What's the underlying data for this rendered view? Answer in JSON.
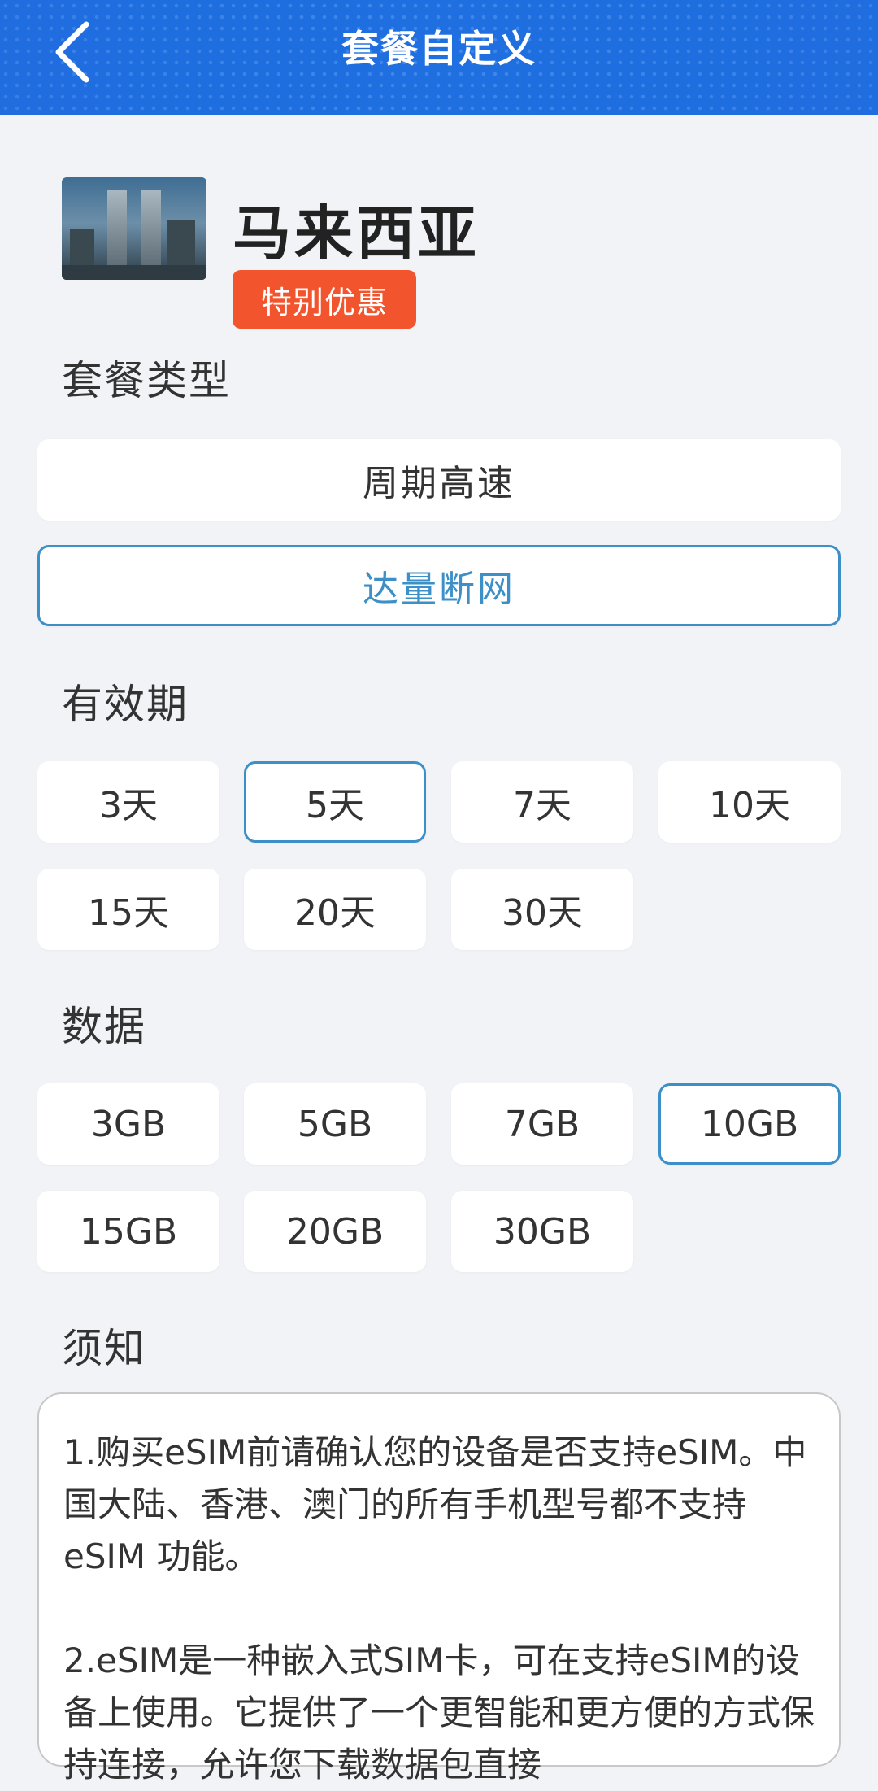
{
  "header": {
    "title": "套餐自定义"
  },
  "product": {
    "country": "马来西亚",
    "badge": "特别优惠"
  },
  "plan_type": {
    "title": "套餐类型",
    "options": [
      "周期高速",
      "达量断网"
    ],
    "selected": "达量断网"
  },
  "validity": {
    "title": "有效期",
    "options": [
      "3天",
      "5天",
      "7天",
      "10天",
      "15天",
      "20天",
      "30天"
    ],
    "selected": "5天"
  },
  "data_plan": {
    "title": "数据",
    "options": [
      "3GB",
      "5GB",
      "7GB",
      "10GB",
      "15GB",
      "20GB",
      "30GB"
    ],
    "selected": "10GB"
  },
  "notice": {
    "title": "须知",
    "paragraphs": [
      "1.购买eSIM前请确认您的设备是否支持eSIM。中国大陆、香港、澳门的所有手机型号都不支持 eSIM 功能。",
      "2.eSIM是一种嵌入式SIM卡，可在支持eSIM的设备上使用。它提供了一个更智能和更方便的方式保持连接，允许您下载数据包直接"
    ]
  },
  "colors": {
    "header": "#1f6fe0",
    "selected": "#3d8fc8",
    "badge": "#f2542d",
    "background": "#f2f3f7"
  }
}
